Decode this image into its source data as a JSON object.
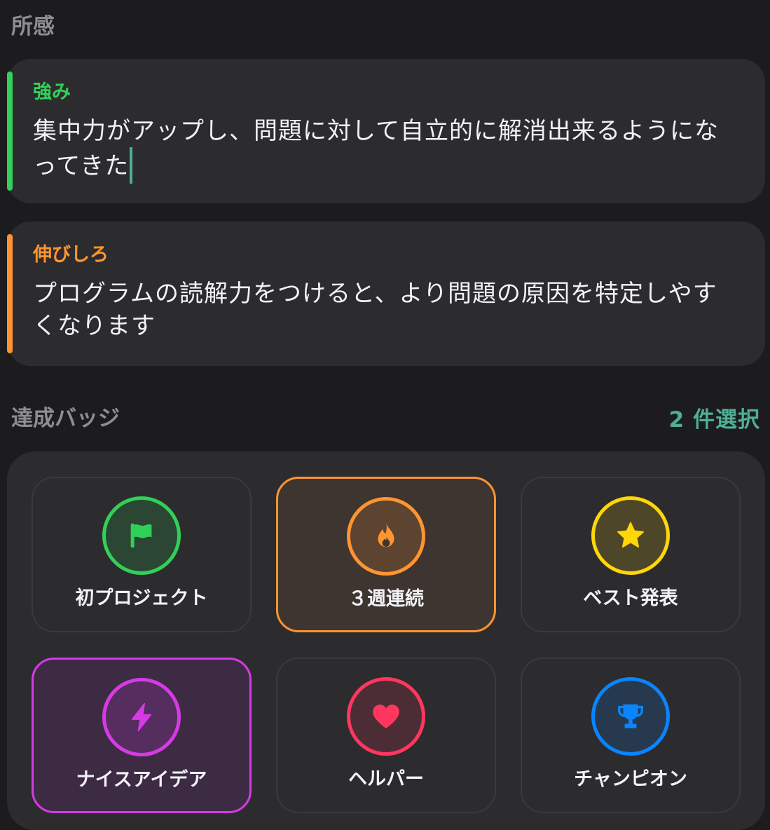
{
  "impressions": {
    "title": "所感",
    "strength": {
      "label": "強み",
      "text": "集中力がアップし、問題に対して自立的に解消出来るようになってきた",
      "color": "#32d15c"
    },
    "growth": {
      "label": "伸びしろ",
      "text": "プログラムの読解力をつけると、より問題の原因を特定しやすくなります",
      "color": "#ff9431"
    }
  },
  "badges": {
    "title": "達成バッジ",
    "selected_count": "2 件選択",
    "items": [
      {
        "name": "初プロジェクト",
        "icon": "flag-icon",
        "color": "#30d158",
        "selected": false
      },
      {
        "name": "３週連続",
        "icon": "flame-icon",
        "color": "#ff9431",
        "selected": true
      },
      {
        "name": "ベスト発表",
        "icon": "star-icon",
        "color": "#ffd60a",
        "selected": false
      },
      {
        "name": "ナイスアイデア",
        "icon": "bolt-icon",
        "color": "#d63ae6",
        "selected": true
      },
      {
        "name": "ヘルパー",
        "icon": "heart-icon",
        "color": "#ff375f",
        "selected": false
      },
      {
        "name": "チャンピオン",
        "icon": "trophy-icon",
        "color": "#0a84ff",
        "selected": false
      }
    ]
  }
}
